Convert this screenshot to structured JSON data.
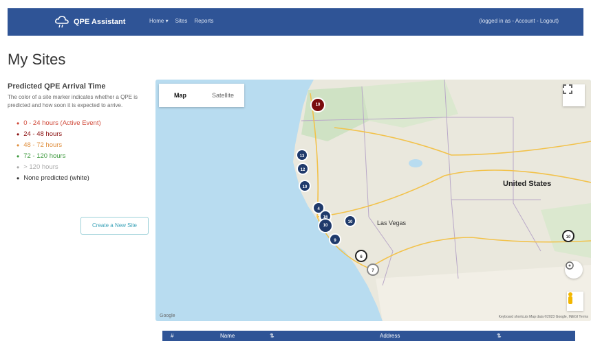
{
  "navbar": {
    "brand": "QPE Assistant",
    "links": [
      "Home ▾",
      "Sites",
      "Reports"
    ],
    "user_text": "(logged in as  - Account - Logout)"
  },
  "page": {
    "title": "My Sites"
  },
  "legend": {
    "heading": "Predicted QPE Arrival Time",
    "description": "The color of a site marker indicates whether a QPE is predicted and how soon it is expected to arrive.",
    "items": [
      {
        "label": "0 - 24 hours (Active Event)",
        "color": "#d04a3a"
      },
      {
        "label": "24 - 48 hours",
        "color": "#8a1010"
      },
      {
        "label": "48 - 72 hours",
        "color": "#e09040"
      },
      {
        "label": "72 - 120 hours",
        "color": "#3f9a3f"
      },
      {
        "label": "> 120 hours",
        "color": "#aaaaaa"
      },
      {
        "label": "None predicted (white)",
        "color": "#333333"
      }
    ],
    "create_button": "Create a New Site"
  },
  "map": {
    "tabs": [
      "Map",
      "Satellite"
    ],
    "active_tab": "Map",
    "country_label": "United States",
    "region_labels": [
      "Las Vegas"
    ],
    "markers": [
      "10",
      "13",
      "12",
      "10",
      "4",
      "16",
      "10",
      "9",
      "6",
      "7",
      "10"
    ],
    "attribution": "Keyboard shortcuts   Map data ©2023 Google, INEGI   Terms",
    "google_logo": "Google"
  },
  "table": {
    "columns": [
      "#",
      "Name",
      "Address"
    ]
  },
  "colors": {
    "navbar": "#2f5496",
    "marker_blue": "#1f3a6b",
    "marker_red": "#7a0d0d"
  }
}
